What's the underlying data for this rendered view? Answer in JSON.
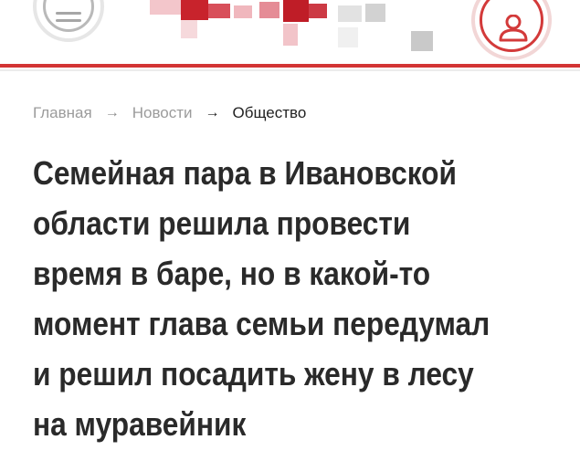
{
  "header": {
    "menu_icon": "hamburger-menu-icon",
    "user_icon": "user-profile-icon",
    "logo_colors": [
      "#c41e2a",
      "#e8a0a8",
      "#f4c9ce",
      "#9e9e9e",
      "#d9d9d9"
    ],
    "accent_color": "#d33434"
  },
  "breadcrumb": {
    "items": [
      "Главная",
      "Новости",
      "Общество"
    ],
    "separator": "→"
  },
  "article": {
    "title": "Семейная пара в Ивановской области решила провести время в баре, но в какой-то момент глава семьи передумал и решил посадить жену в лесу на муравейник"
  }
}
